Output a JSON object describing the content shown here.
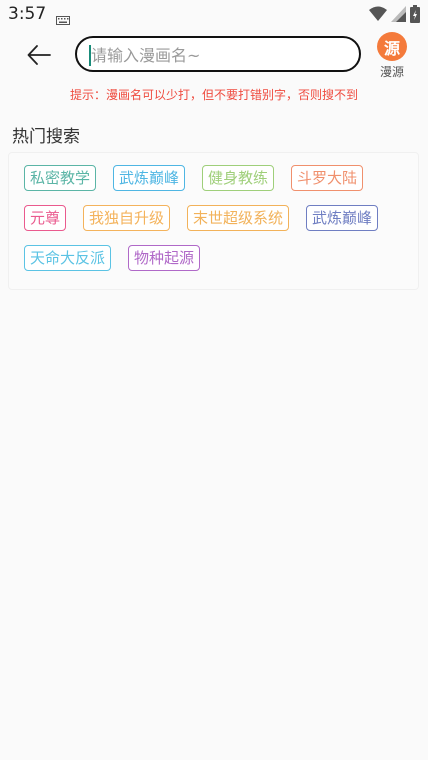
{
  "status_bar": {
    "time": "3:57",
    "icons": [
      "keyboard-icon",
      "wifi-icon",
      "signal-icon",
      "battery-charging-icon"
    ]
  },
  "header": {
    "back_icon": "arrow-left-icon",
    "search": {
      "value": "",
      "placeholder": "请输入漫画名~"
    },
    "source": {
      "badge": "源",
      "label": "漫源"
    }
  },
  "tip": "提示：漫画名可以少打，但不要打错别字，否则搜不到",
  "hot_search": {
    "title": "热门搜索",
    "tags": [
      {
        "label": "私密教学",
        "color": "#5bb5a6"
      },
      {
        "label": "武炼巅峰",
        "color": "#4fb6e3"
      },
      {
        "label": "健身教练",
        "color": "#9fcf7a"
      },
      {
        "label": "斗罗大陆",
        "color": "#f0906d"
      },
      {
        "label": "元尊",
        "color": "#ea5a8e"
      },
      {
        "label": "我独自升级",
        "color": "#f4b35c"
      },
      {
        "label": "末世超级系统",
        "color": "#f2b25a"
      },
      {
        "label": "武炼巅峰",
        "color": "#6f7ec2"
      },
      {
        "label": "天命大反派",
        "color": "#5bc3e4"
      },
      {
        "label": "物种起源",
        "color": "#b069c8"
      }
    ]
  }
}
